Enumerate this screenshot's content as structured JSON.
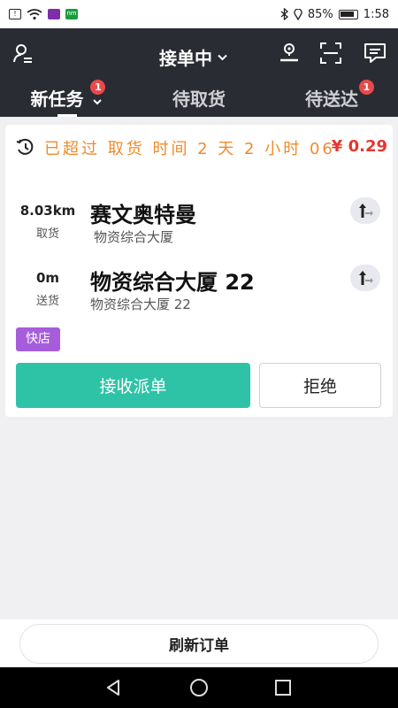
{
  "status_bar": {
    "chip_sim": "SIM",
    "chip_app": "",
    "chip_green": "nm",
    "battery": "85%",
    "time": "1:58"
  },
  "header": {
    "status_label": "接单中",
    "tabs": [
      {
        "label": "新任务",
        "badge": "1"
      },
      {
        "label": "待取货",
        "badge": ""
      },
      {
        "label": "待送达",
        "badge": "1"
      }
    ]
  },
  "order": {
    "overdue_text": "已超过 取货 时间 2 天 2 小时 06",
    "price": "¥ 0.29",
    "pickup": {
      "distance": "8.03km",
      "label": "取货",
      "name": "赛文奥特曼",
      "address": "物资综合大厦"
    },
    "dropoff": {
      "distance": "0m",
      "label": "送货",
      "name": "物资综合大厦 22",
      "address": "物资综合大厦 22"
    },
    "tag": "快店",
    "accept_label": "接收派单",
    "reject_label": "拒绝"
  },
  "footer": {
    "refresh_label": "刷新订单"
  },
  "colors": {
    "header_bg": "#2a2c33",
    "accent_green": "#2ec3a7",
    "overdue_orange": "#f08a2c",
    "price_red": "#e6362e",
    "tag_purple": "#a65ddb",
    "badge_red": "#e84a4a"
  }
}
